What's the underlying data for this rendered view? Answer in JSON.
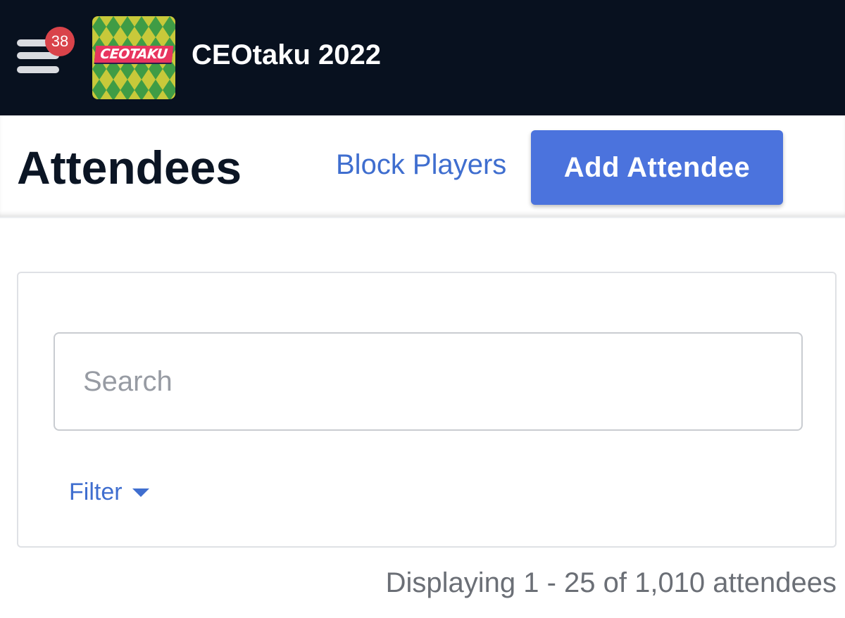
{
  "header": {
    "menu_icon": "hamburger-menu-icon",
    "notification_count": "38",
    "logo_text": "CEOTAKU",
    "logo_colors": {
      "green": "#3d9a3a",
      "yellow": "#d8d53a",
      "pink": "#e8355f"
    },
    "event_title": "CEOtaku 2022",
    "background": "#08111f"
  },
  "page": {
    "title": "Attendees",
    "block_players_label": "Block Players",
    "add_attendee_label": "Add Attendee",
    "accent_color": "#4b73dd",
    "link_color": "#3f6ecf"
  },
  "search": {
    "placeholder": "Search",
    "value": ""
  },
  "filter": {
    "label": "Filter",
    "icon": "caret-down-icon"
  },
  "results": {
    "summary": "Displaying 1 - 25 of 1,010 attendees"
  }
}
